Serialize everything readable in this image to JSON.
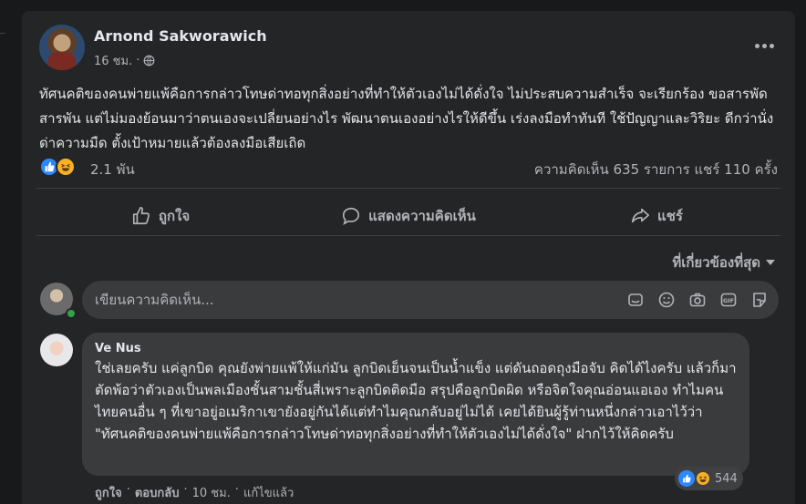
{
  "post": {
    "author": "Arnond Sakworawich",
    "time": "16 ชม.",
    "privacy_icon": "globe-icon",
    "text": "ทัศนคติของคนพ่ายแพ้คือการกล่าวโทษด่าทอทุกสิ่งอย่างที่ทำให้ตัวเองไม่ได้ดั่งใจ ไม่ประสบความสำเร็จ จะเรียกร้อง ขอสารพัดสารพัน แต่ไม่มองย้อนมาว่าตนเองจะเปลี่ยนอย่างไร พัฒนาตนเองอย่างไรให้ดีขึ้น เร่งลงมือทำทันที ใช้ปัญญาและวิริยะ ดีกว่านั่งด่าความมืด ตั้งเป้าหมายแล้วต้องลงมือเสียเถิด",
    "reaction_count": "2.1 พัน",
    "stats": "ความคิดเห็น 635 รายการ  แชร์ 110 ครั้ง"
  },
  "actions": {
    "like": "ถูกใจ",
    "comment": "แสดงความคิดเห็น",
    "share": "แชร์"
  },
  "sort_label": "ที่เกี่ยวข้องที่สุด",
  "comment_box": {
    "placeholder": "เขียนความคิดเห็น..."
  },
  "comment": {
    "author": "Ve Nus",
    "text": "ใช่เลยครับ แค่ลูกบิด คุณยังพ่ายแพ้ให้แก่มัน ลูกบิดเย็นจนเป็นน้ำแข็ง แต่ดันถอดถุงมือจับ คิดได้ไงครับ แล้วก็มาตัดพ้อว่าตัวเองเป็นพลเมืองชั้นสามชั้นสี่เพราะลูกบิดติดมือ สรุปคือลูกบิดผิด หรือจิตใจคุณอ่อนแอเอง ทำไมคนไทยคนอื่น ๆ ที่เขาอยู่อเมริกาเขายังอยู่กันได้แต่ทำไมคุณกลับอยู่ไม่ได้ เคยได้ยินผู้รู้ท่านหนึ่งกล่าวเอาไว้ว่า \"ทัศนคติของคนพ่ายแพ้คือการกล่าวโทษด่าทอทุกสิ่งอย่างที่ทำให้ตัวเองไม่ได้ดั่งใจ\" ฝากไว้ให้คิดครับ",
    "reaction_count": "544",
    "like": "ถูกใจ",
    "reply": "ตอบกลับ",
    "time": "10 ชม.",
    "edited": "แก้ไขแล้ว",
    "sep": "·"
  },
  "colors": {
    "background": "#18191a",
    "card": "#242526",
    "bubble": "#3a3b3c",
    "text": "#e4e6eb",
    "muted": "#b0b3b8",
    "like_blue": "#2d88ff",
    "haha_yellow": "#f7b125"
  }
}
